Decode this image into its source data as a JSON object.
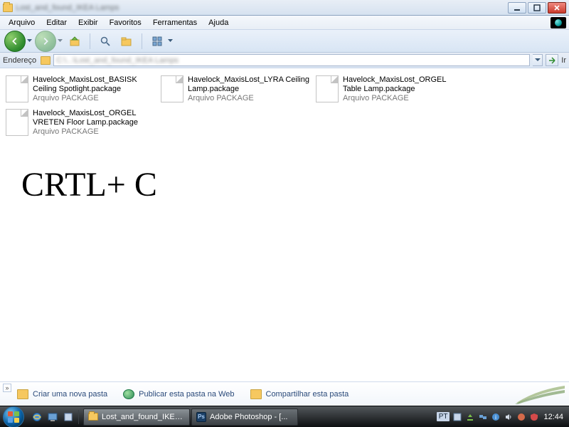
{
  "window": {
    "title": "Lost_and_found_IKEA Lamps"
  },
  "menu": {
    "arquivo": "Arquivo",
    "editar": "Editar",
    "exibir": "Exibir",
    "favoritos": "Favoritos",
    "ferramentas": "Ferramentas",
    "ajuda": "Ajuda"
  },
  "address": {
    "label": "Endereço",
    "path": "C:\\...\\Lost_and_found_IKEA Lamps",
    "go": "Ir"
  },
  "files": [
    {
      "name": "Havelock_MaxisLost_BASISK Ceiling Spotlight.package",
      "type": "Arquivo PACKAGE"
    },
    {
      "name": "Havelock_MaxisLost_LYRA Ceiling Lamp.package",
      "type": "Arquivo PACKAGE"
    },
    {
      "name": "Havelock_MaxisLost_ORGEL Table Lamp.package",
      "type": "Arquivo PACKAGE"
    },
    {
      "name": "Havelock_MaxisLost_ORGEL VRETEN Floor Lamp.package",
      "type": "Arquivo PACKAGE"
    }
  ],
  "overlay_text": "CRTL+ C",
  "tasks": {
    "new_folder": "Criar uma nova pasta",
    "publish": "Publicar esta pasta na Web",
    "share": "Compartilhar esta pasta"
  },
  "taskbar": {
    "app1": "Lost_and_found_IKE…",
    "app2": "Adobe Photoshop - [...",
    "lang": "PT",
    "clock": "12:44"
  },
  "colors": {
    "accent": "#2e8b2e",
    "link": "#2a4a7a"
  }
}
